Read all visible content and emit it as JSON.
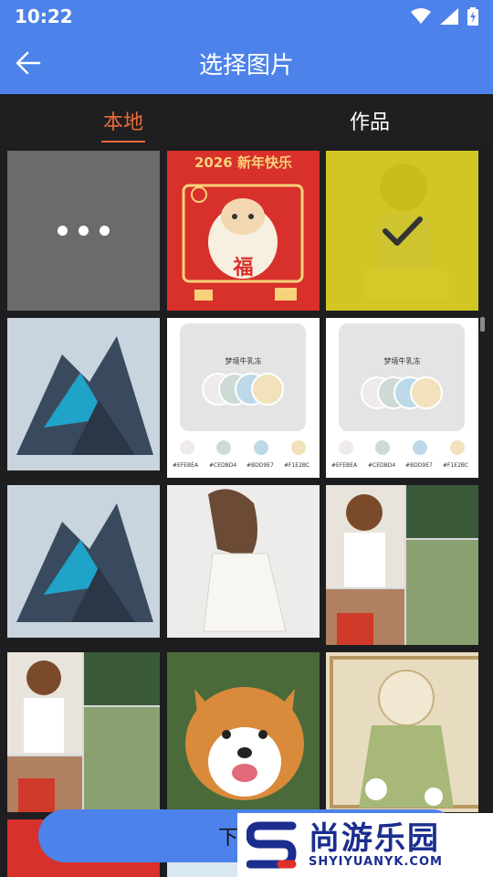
{
  "status": {
    "time": "10:22",
    "icons": [
      "wifi-icon",
      "signal-icon",
      "battery-charging-icon"
    ]
  },
  "appbar": {
    "title": "选择图片",
    "back_icon": "arrow-left-icon"
  },
  "tabs": [
    {
      "label": "本地",
      "active": true
    },
    {
      "label": "作品",
      "active": false
    }
  ],
  "grid": {
    "more_icon": "more-dots-icon",
    "items": [
      {
        "kind": "more"
      },
      {
        "kind": "image",
        "desc": "new-year-card",
        "caption": "2026 新年快乐",
        "char": "福"
      },
      {
        "kind": "image",
        "desc": "anime-girl",
        "selected": true
      },
      {
        "kind": "image",
        "desc": "mecha-robot"
      },
      {
        "kind": "image",
        "desc": "palette-card",
        "card_title": "梦境牛乳冻",
        "colors": [
          "#EFEBEA",
          "#CEDBD4",
          "#BDD9E7",
          "#F1E2BC"
        ]
      },
      {
        "kind": "image",
        "desc": "palette-card",
        "card_title": "梦境牛乳冻",
        "colors": [
          "#EFEBEA",
          "#CEDBD4",
          "#BDD9E7",
          "#F1E2BC"
        ]
      },
      {
        "kind": "image",
        "desc": "mecha-robot"
      },
      {
        "kind": "image",
        "desc": "girl-white-dress"
      },
      {
        "kind": "image",
        "desc": "meme-collage"
      },
      {
        "kind": "image",
        "desc": "meme-collage"
      },
      {
        "kind": "image",
        "desc": "corgi"
      },
      {
        "kind": "image",
        "desc": "art-nouveau"
      }
    ]
  },
  "next_button": {
    "label": "下一步"
  },
  "watermark": {
    "main": "尚游乐园",
    "sub": "SHYIYUANYK.COM"
  }
}
